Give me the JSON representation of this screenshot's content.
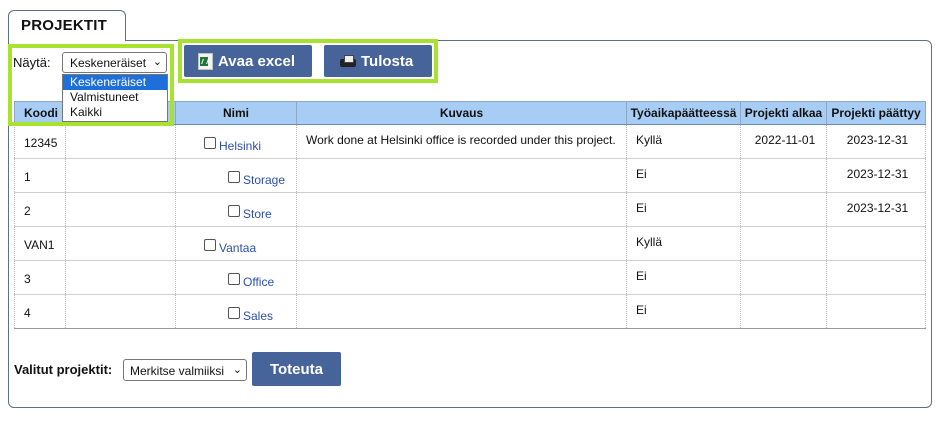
{
  "tab": {
    "title": "PROJEKTIT"
  },
  "filter": {
    "label": "Näytä:",
    "selected": "Keskeneräiset",
    "options": [
      "Keskeneräiset",
      "Valmistuneet",
      "Kaikki"
    ]
  },
  "toolbar": {
    "excel_label": "Avaa excel",
    "excel_icon": "excel-icon",
    "print_label": "Tulosta",
    "print_icon": "printer-icon"
  },
  "table": {
    "headers": [
      "Koodi",
      "Nimi",
      "Kuvaus",
      "Työaikapäätteessä",
      "Projekti alkaa",
      "Projekti päättyy"
    ],
    "rows": [
      {
        "code": "12345",
        "name": "Helsinki",
        "level": 0,
        "description": "Work done at Helsinki office is recorded under this project.",
        "terminal": "Kyllä",
        "start": "2022-11-01",
        "end": "2023-12-31"
      },
      {
        "code": "1",
        "name": "Storage",
        "level": 1,
        "description": "",
        "terminal": "Ei",
        "start": "",
        "end": "2023-12-31"
      },
      {
        "code": "2",
        "name": "Store",
        "level": 1,
        "description": "",
        "terminal": "Ei",
        "start": "",
        "end": "2023-12-31"
      },
      {
        "code": "VAN1",
        "name": "Vantaa",
        "level": 0,
        "description": "",
        "terminal": "Kyllä",
        "start": "",
        "end": ""
      },
      {
        "code": "3",
        "name": "Office",
        "level": 1,
        "description": "",
        "terminal": "Ei",
        "start": "",
        "end": ""
      },
      {
        "code": "4",
        "name": "Sales",
        "level": 1,
        "description": "",
        "terminal": "Ei",
        "start": "",
        "end": ""
      }
    ]
  },
  "bulk": {
    "label": "Valitut projektit:",
    "action": "Merkitse valmiiksi",
    "submit_label": "Toteuta"
  },
  "colors": {
    "header_bg": "#a8cdf5",
    "button_bg": "#46649a",
    "highlight": "#a6e22e",
    "link": "#2b4faa"
  }
}
